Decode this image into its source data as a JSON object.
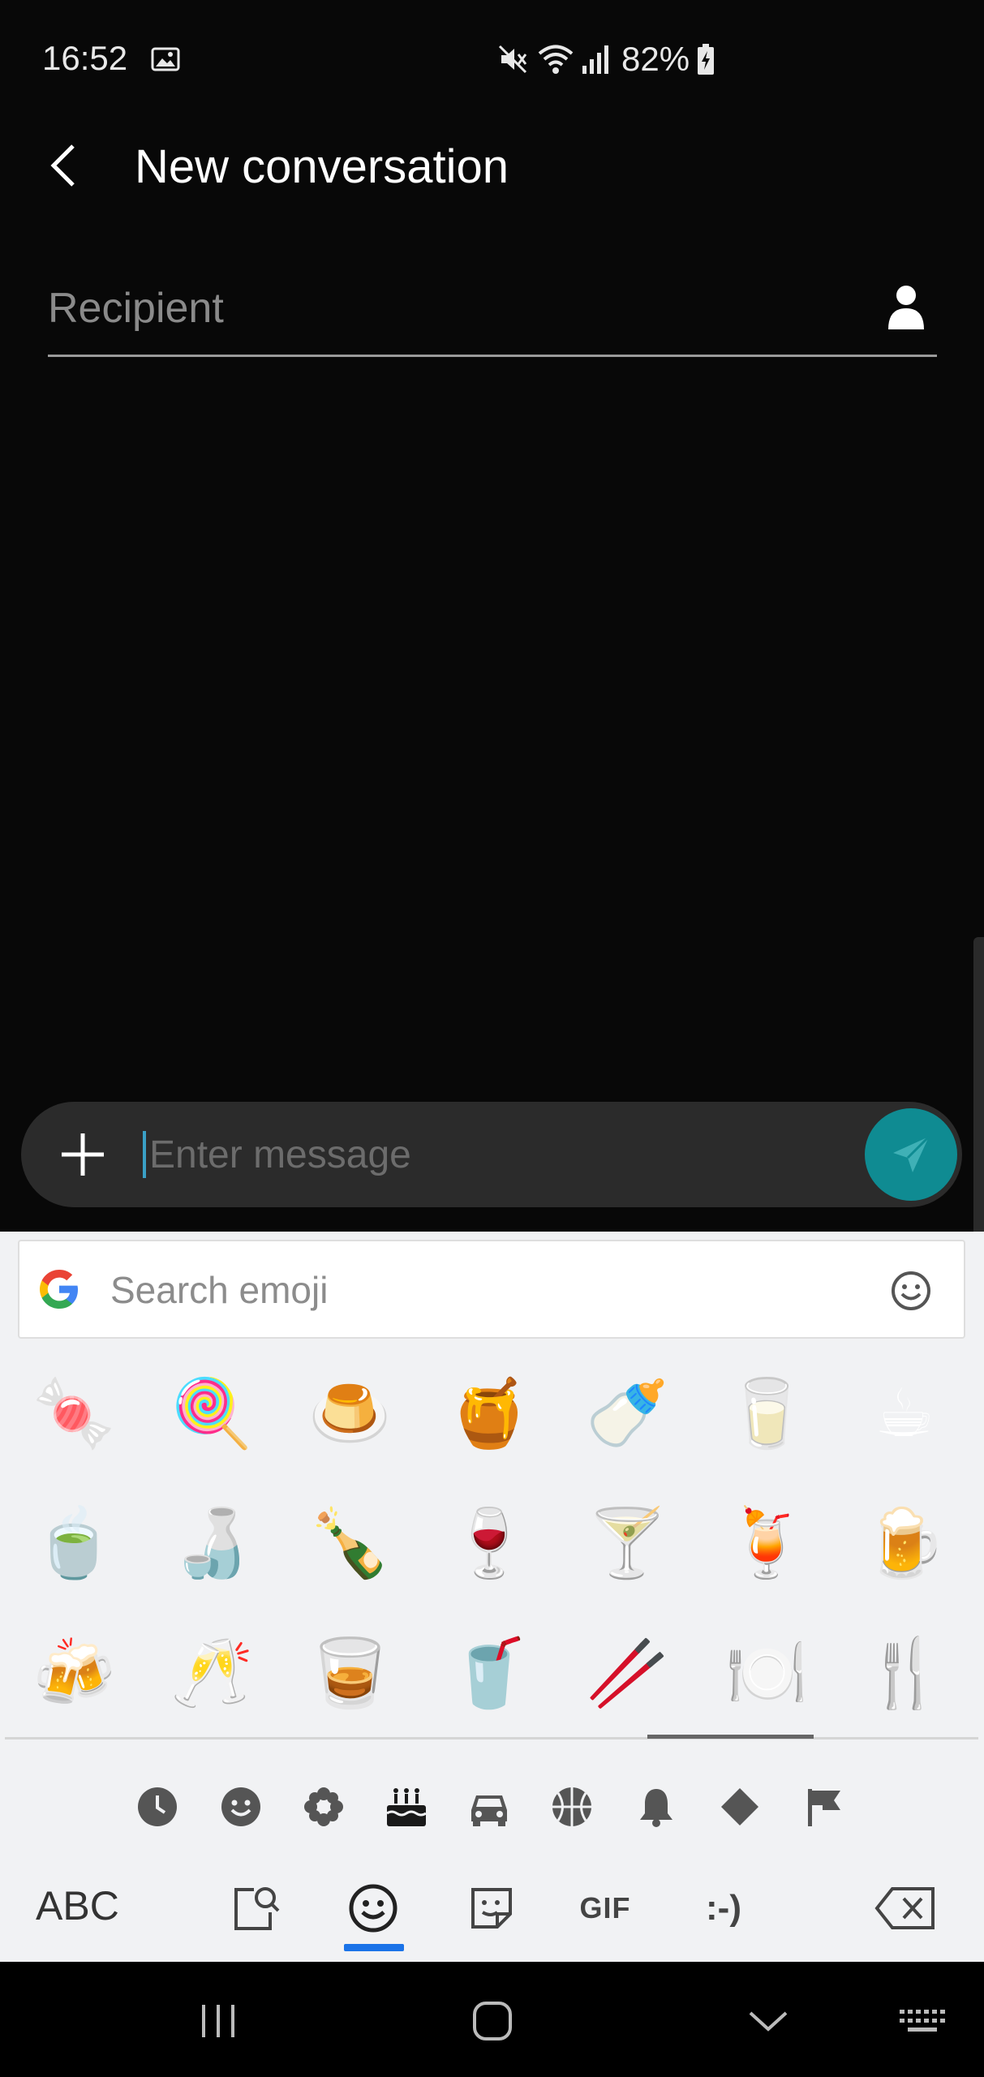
{
  "status_bar": {
    "time": "16:52",
    "battery": "82%",
    "icons": [
      "image-notification-icon",
      "mute-icon",
      "wifi-icon",
      "signal-icon",
      "battery-icon"
    ]
  },
  "header": {
    "title": "New conversation",
    "back_icon": "back-arrow-icon"
  },
  "recipient": {
    "placeholder": "Recipient",
    "icon": "contact-icon"
  },
  "compose": {
    "placeholder": "Enter message",
    "attach_icon": "plus-icon",
    "send_icon": "send-icon",
    "accent": "#0f8b92"
  },
  "keyboard": {
    "search_placeholder": "Search emoji",
    "emoji_rows": [
      [
        "🍬",
        "🍭",
        "🍮",
        "🍯",
        "🍼",
        "🥛",
        "☕"
      ],
      [
        "🍵",
        "🍶",
        "🍾",
        "🍷",
        "🍸",
        "🍹",
        "🍺"
      ],
      [
        "🍻",
        "🥂",
        "🥃",
        "🥤",
        "🥢",
        "🍽️",
        "🍴"
      ]
    ],
    "categories": [
      "recent-icon",
      "smileys-icon",
      "nature-icon",
      "food-icon",
      "travel-icon",
      "activity-icon",
      "objects-icon",
      "symbols-icon",
      "flags-icon"
    ],
    "active_category": "food-icon",
    "abc_label": "ABC",
    "gif_label": "GIF",
    "emoticon_label": ":-)",
    "active_tool": "emoji",
    "active_color": "#1a73e8"
  },
  "nav": {
    "buttons": [
      "recents-icon",
      "home-icon",
      "hide-keyboard-icon",
      "keyboard-icon"
    ]
  }
}
